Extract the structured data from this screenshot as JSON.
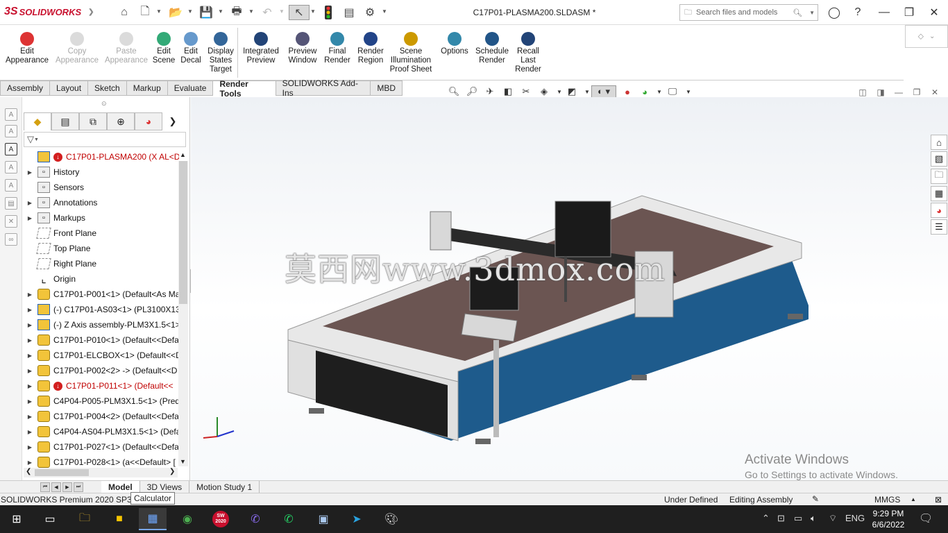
{
  "titlebar": {
    "brand": "SOLIDWORKS",
    "brand_mark": "3S",
    "document_title": "C17P01-PLASMA200.SLDASM *",
    "search_placeholder": "Search files and models",
    "icons": [
      "home-icon",
      "new-document-icon",
      "open-icon",
      "save-icon",
      "print-icon",
      "undo-icon",
      "select-icon",
      "rebuild-icon",
      "file-properties-icon",
      "options-icon"
    ]
  },
  "command_manager": {
    "buttons": [
      {
        "label": "Edit\nAppearance",
        "enabled": true
      },
      {
        "label": "Copy\nAppearance",
        "enabled": false
      },
      {
        "label": "Paste\nAppearance",
        "enabled": false
      },
      {
        "label": "Edit\nScene",
        "enabled": true
      },
      {
        "label": "Edit\nDecal",
        "enabled": true
      },
      {
        "label": "Display\nStates\nTarget",
        "enabled": true
      },
      {
        "label": "Integrated\nPreview",
        "enabled": true
      },
      {
        "label": "Preview\nWindow",
        "enabled": true
      },
      {
        "label": "Final\nRender",
        "enabled": true
      },
      {
        "label": "Render\nRegion",
        "enabled": true
      },
      {
        "label": "Scene\nIllumination\nProof Sheet",
        "enabled": true
      },
      {
        "label": "Options",
        "enabled": true
      },
      {
        "label": "Schedule\nRender",
        "enabled": true
      },
      {
        "label": "Recall\nLast\nRender",
        "enabled": true
      }
    ]
  },
  "tabs": [
    "Assembly",
    "Layout",
    "Sketch",
    "Markup",
    "Evaluate",
    "Render Tools",
    "SOLIDWORKS Add-Ins",
    "MBD"
  ],
  "active_tab": "Render Tools",
  "feature_tree": {
    "rows": [
      {
        "label": "C17P01-PLASMA200  (X AL<Disp",
        "expander": false,
        "icon": "asm",
        "error": true,
        "red": true
      },
      {
        "label": "History",
        "expander": true,
        "icon": "folder",
        "error": false,
        "red": false
      },
      {
        "label": "Sensors",
        "expander": false,
        "icon": "folder",
        "error": false,
        "red": false
      },
      {
        "label": "Annotations",
        "expander": true,
        "icon": "folder",
        "error": false,
        "red": false
      },
      {
        "label": "Markups",
        "expander": true,
        "icon": "folder",
        "error": false,
        "red": false
      },
      {
        "label": "Front Plane",
        "expander": false,
        "icon": "plane",
        "error": false,
        "red": false
      },
      {
        "label": "Top Plane",
        "expander": false,
        "icon": "plane",
        "error": false,
        "red": false
      },
      {
        "label": "Right Plane",
        "expander": false,
        "icon": "plane",
        "error": false,
        "red": false
      },
      {
        "label": "Origin",
        "expander": false,
        "icon": "origin",
        "error": false,
        "red": false
      },
      {
        "label": "C17P01-P001<1> (Default<As Ma",
        "expander": true,
        "icon": "part",
        "error": false,
        "red": false
      },
      {
        "label": "(-) C17P01-AS03<1> (PL3100X135",
        "expander": true,
        "icon": "asm",
        "error": false,
        "red": false
      },
      {
        "label": "(-) Z Axis assembly-PLM3X1.5<1>",
        "expander": true,
        "icon": "asm",
        "error": false,
        "red": false
      },
      {
        "label": "C17P01-P010<1> (Default<<Defa",
        "expander": true,
        "icon": "part",
        "error": false,
        "red": false
      },
      {
        "label": "C17P01-ELCBOX<1> (Default<<D",
        "expander": true,
        "icon": "part",
        "error": false,
        "red": false
      },
      {
        "label": "C17P01-P002<2> -> (Default<<D",
        "expander": true,
        "icon": "part",
        "error": false,
        "red": false
      },
      {
        "label": "C17P01-P011<1> (Default<<",
        "expander": true,
        "icon": "part",
        "error": true,
        "red": true
      },
      {
        "label": "C4P04-P005-PLM3X1.5<1> (Pred",
        "expander": true,
        "icon": "part",
        "error": false,
        "red": false
      },
      {
        "label": "C17P01-P004<2> (Default<<Defa",
        "expander": true,
        "icon": "part",
        "error": false,
        "red": false
      },
      {
        "label": "C4P04-AS04-PLM3X1.5<1> (Defa",
        "expander": true,
        "icon": "part",
        "error": false,
        "red": false
      },
      {
        "label": "C17P01-P027<1> (Default<<Defa",
        "expander": true,
        "icon": "part",
        "error": false,
        "red": false
      },
      {
        "label": "C17P01-P028<1> (a<<Default> [",
        "expander": true,
        "icon": "part",
        "error": false,
        "red": false
      }
    ]
  },
  "viewport": {
    "watermark": "莫西网www.3dmox.com",
    "activate_title": "Activate Windows",
    "activate_sub": "Go to Settings to activate Windows."
  },
  "bottom_tabs": [
    "Model",
    "3D Views",
    "Motion Study 1"
  ],
  "active_bottom_tab": "Model",
  "status": {
    "product": "SOLIDWORKS Premium 2020 SP3.0",
    "tooltip": "Calculator",
    "under_defined": "Under Defined",
    "editing": "Editing Assembly",
    "units": "MMGS"
  },
  "taskbar": {
    "language": "ENG",
    "time": "9:29 PM",
    "date": "6/6/2022",
    "sw_badge": "2020"
  },
  "colors": {
    "brand_red": "#c8102e",
    "machine_blue": "#1e5b8c",
    "error_red": "#d31f1f"
  }
}
